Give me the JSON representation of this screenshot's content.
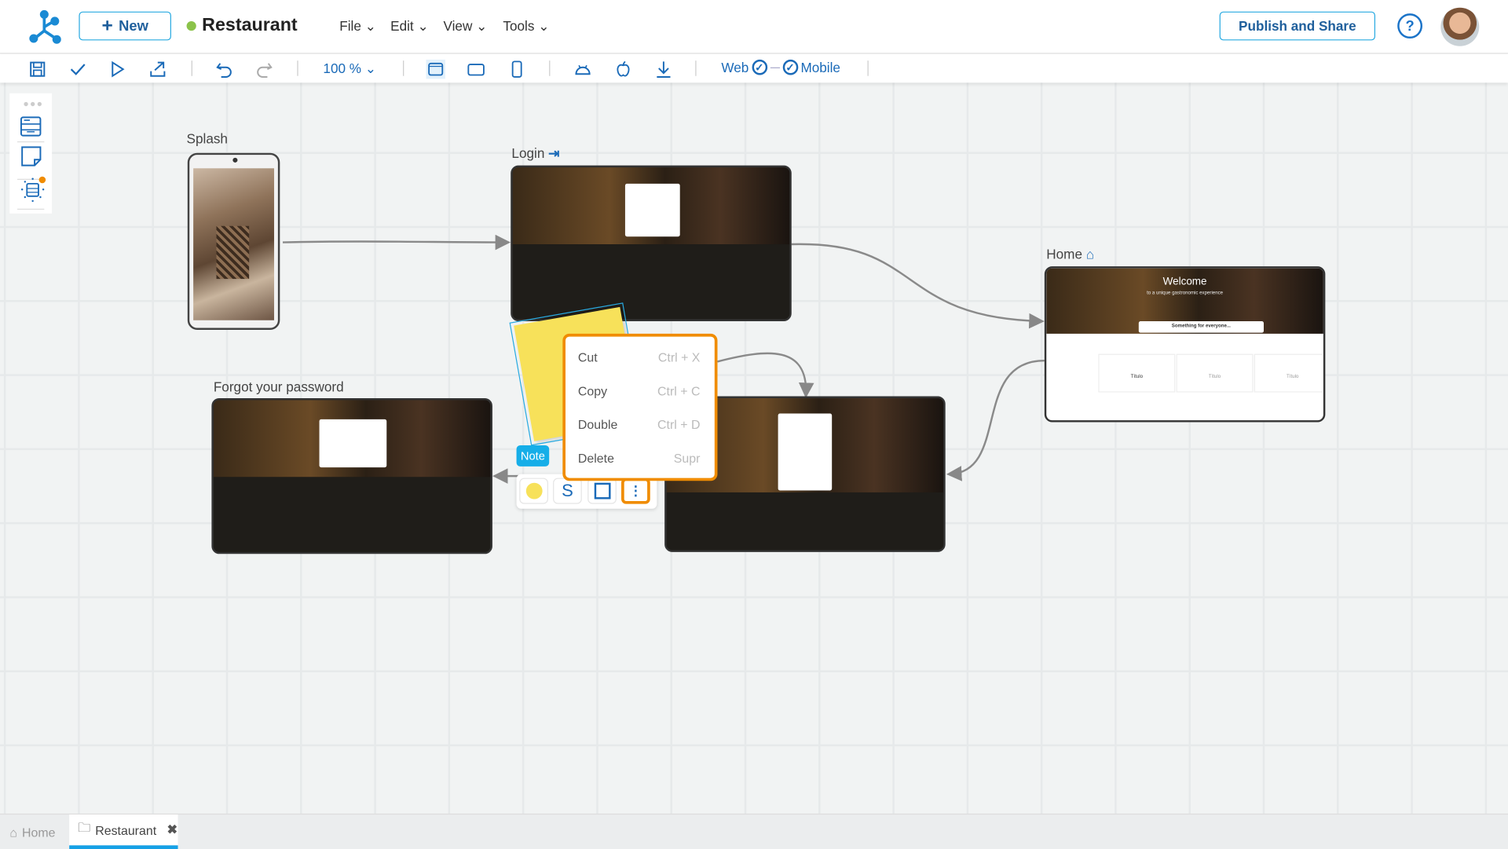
{
  "header": {
    "new_label": "New",
    "project_title": "Restaurant",
    "project_status_color": "#8bc34a",
    "menus": [
      "File",
      "Edit",
      "View",
      "Tools"
    ],
    "publish_label": "Publish and Share",
    "help_label": "?"
  },
  "toolbar": {
    "zoom": "100 %",
    "web_label": "Web",
    "mobile_label": "Mobile",
    "web_enabled": true,
    "mobile_enabled": true
  },
  "canvas": {
    "screens": {
      "splash": {
        "label": "Splash"
      },
      "login": {
        "label": "Login"
      },
      "home": {
        "label": "Home",
        "hero_title": "Welcome",
        "hero_subtitle": "to a unique gastronomic experience",
        "section_title": "Something for everyone...",
        "cards": [
          "Título",
          "Título",
          "Título"
        ]
      },
      "forgot": {
        "label": "Forgot your password"
      },
      "register": {
        "label": ""
      }
    },
    "note": {
      "badge": "Note",
      "color": "#f7e15a"
    },
    "context_menu": [
      {
        "label": "Cut",
        "shortcut": "Ctrl + X"
      },
      {
        "label": "Copy",
        "shortcut": "Ctrl + C"
      },
      {
        "label": "Double",
        "shortcut": "Ctrl + D"
      },
      {
        "label": "Delete",
        "shortcut": "Supr"
      }
    ],
    "note_toolbar": {
      "style_label": "S"
    }
  },
  "tabs": [
    {
      "label": "Home",
      "active": false
    },
    {
      "label": "Restaurant",
      "active": true
    }
  ],
  "colors": {
    "accent": "#29aae1",
    "primary": "#1a6ab8",
    "highlight": "#f08c00"
  }
}
